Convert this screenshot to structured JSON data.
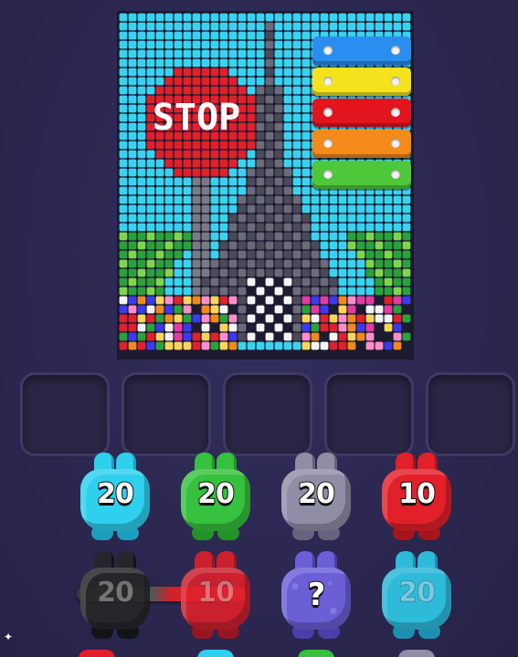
{
  "board": {
    "sign_text": "STOP",
    "colors": {
      "sky": "#39d3f0",
      "sign": "#e0202a",
      "tower": "#6b6b7a",
      "tree": "#2aa23a",
      "ground": "#1c1b30"
    }
  },
  "xylophone": {
    "bars": [
      {
        "color": "#2a8ef0"
      },
      {
        "color": "#f4e21c"
      },
      {
        "color": "#e2141e"
      },
      {
        "color": "#f48a1a"
      },
      {
        "color": "#4ec83a"
      }
    ]
  },
  "slots": {
    "count": 5
  },
  "pieces": {
    "row1": [
      {
        "label": "20",
        "color": "#2fd0ee",
        "dark": "#1b9fbf"
      },
      {
        "label": "20",
        "color": "#36c13e",
        "dark": "#24922a"
      },
      {
        "label": "20",
        "color": "#8f8ea6",
        "dark": "#65647c"
      },
      {
        "label": "10",
        "color": "#e2202a",
        "dark": "#a8141c"
      }
    ],
    "row2": [
      {
        "label": "20",
        "color": "#262626",
        "dark": "#111111",
        "dim": true
      },
      {
        "label": "10",
        "color": "#e2202a",
        "dark": "#a8141c",
        "dim": true
      },
      {
        "label": "?",
        "color": "#6b5fd6",
        "dark": "#4a3fa8",
        "mystery": true
      },
      {
        "label": "20",
        "color": "#2fd0ee",
        "dark": "#1b9fbf",
        "dim": true
      }
    ]
  }
}
